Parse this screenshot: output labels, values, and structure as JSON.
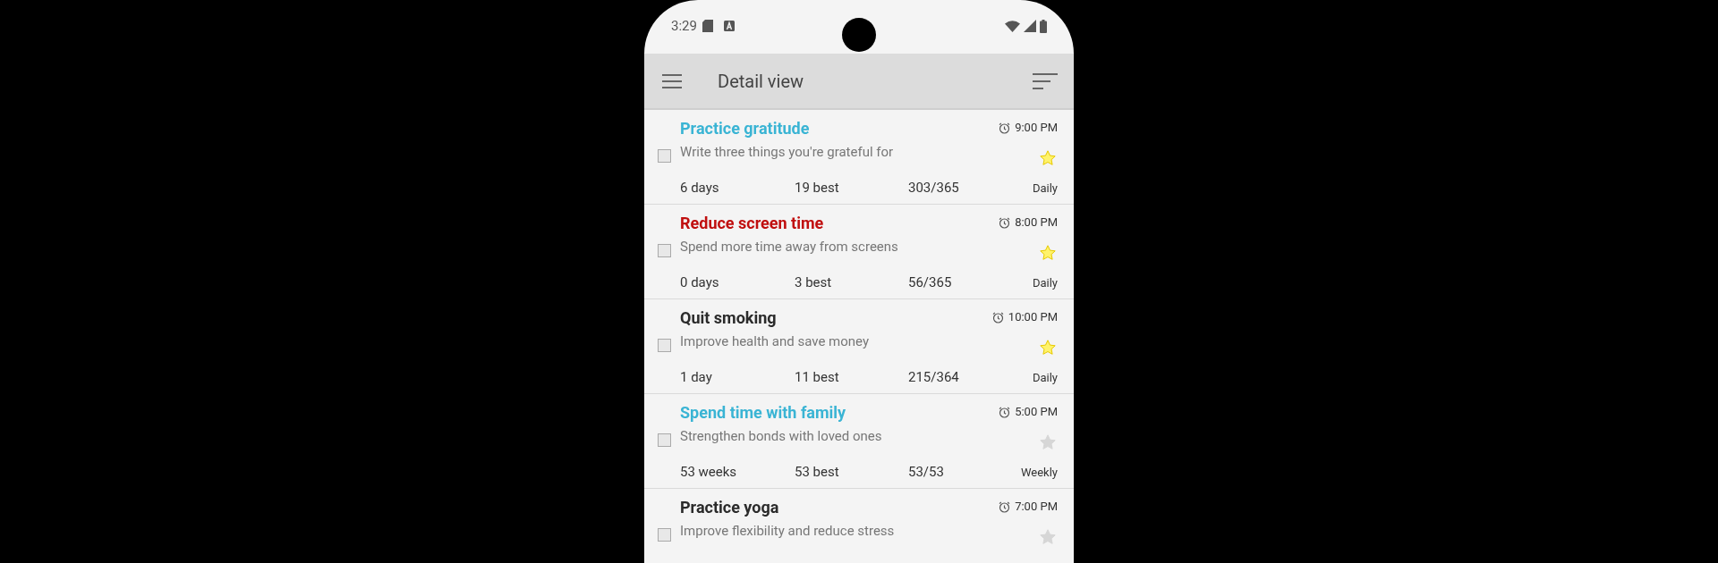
{
  "status_bar": {
    "time": "3:29"
  },
  "toolbar": {
    "title": "Detail view"
  },
  "habits": [
    {
      "title": "Practice gratitude",
      "color": "#3ab4d4",
      "description": "Write three things you're grateful for",
      "reminder": "9:00 PM",
      "starred": true,
      "checked": false,
      "streak": "6 days",
      "best": "19 best",
      "progress": "303/365",
      "frequency": "Daily"
    },
    {
      "title": "Reduce screen time",
      "color": "#c00f0f",
      "description": "Spend more time away from screens",
      "reminder": "8:00 PM",
      "starred": true,
      "checked": false,
      "streak": "0 days",
      "best": "3 best",
      "progress": "56/365",
      "frequency": "Daily"
    },
    {
      "title": "Quit smoking",
      "color": "#2b2b2b",
      "description": "Improve health and save money",
      "reminder": "10:00 PM",
      "starred": true,
      "checked": false,
      "streak": "1 day",
      "best": "11 best",
      "progress": "215/364",
      "frequency": "Daily"
    },
    {
      "title": "Spend time with family",
      "color": "#3ab4d4",
      "description": "Strengthen bonds with loved ones",
      "reminder": "5:00 PM",
      "starred": false,
      "checked": false,
      "streak": "53 weeks",
      "best": "53 best",
      "progress": "53/53",
      "frequency": "Weekly"
    },
    {
      "title": "Practice yoga",
      "color": "#2b2b2b",
      "description": "Improve flexibility and reduce stress",
      "reminder": "7:00 PM",
      "starred": false,
      "checked": false
    }
  ]
}
